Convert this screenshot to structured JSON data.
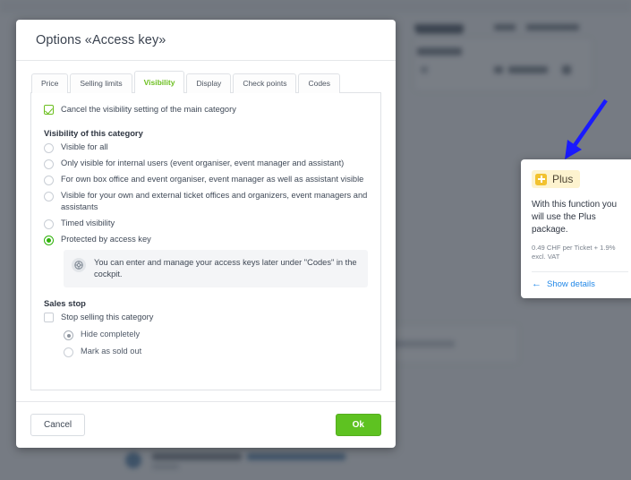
{
  "modal": {
    "title": "Options «Access key»",
    "tabs": [
      {
        "label": "Price",
        "active": false
      },
      {
        "label": "Selling limits",
        "active": false
      },
      {
        "label": "Visibility",
        "active": true
      },
      {
        "label": "Display",
        "active": false
      },
      {
        "label": "Check points",
        "active": false
      },
      {
        "label": "Codes",
        "active": false
      }
    ],
    "cancel_main_checkbox": {
      "label": "Cancel the visibility setting of the main category",
      "checked": true
    },
    "visibility_group": {
      "heading": "Visibility of this category",
      "options": [
        {
          "label": "Visible for all",
          "selected": false
        },
        {
          "label": "Only visible for internal users (event organiser, event manager and assistant)",
          "selected": false
        },
        {
          "label": "For own box office and event organiser, event manager as well as assistant visible",
          "selected": false
        },
        {
          "label": "Visible for your own and external ticket offices and organizers, event managers and assistants",
          "selected": false
        },
        {
          "label": "Timed visibility",
          "selected": false
        },
        {
          "label": "Protected by access key",
          "selected": true
        }
      ],
      "info_note": "You can enter and manage your access keys later under \"Codes\" in the cockpit.",
      "info_icon": "access-key-icon"
    },
    "sales_stop_group": {
      "heading": "Sales stop",
      "checkbox": {
        "label": "Stop selling this category",
        "checked": false
      },
      "options": [
        {
          "label": "Hide completely",
          "selected": true
        },
        {
          "label": "Mark as sold out",
          "selected": false
        }
      ]
    },
    "footer": {
      "cancel_label": "Cancel",
      "ok_label": "Ok"
    }
  },
  "tooltip": {
    "badge_label": "Plus",
    "badge_icon": "plus-square-icon",
    "description": "With this function you will use the Plus package.",
    "price": "0.49 CHF per Ticket + 1.9% excl. VAT",
    "link_label": "Show details",
    "link_icon": "arrow-left-icon"
  },
  "annotation": {
    "arrow_icon": "arrow-down-left-annotation",
    "color": "#1a1aff"
  },
  "colors": {
    "accent_green": "#6cbf1f",
    "ok_button": "#5ec221",
    "link_blue": "#2288e8",
    "plus_yellow": "#f2c230",
    "plus_badge_bg": "#fdf3cf",
    "scrim": "rgba(40,48,60,0.62)"
  }
}
